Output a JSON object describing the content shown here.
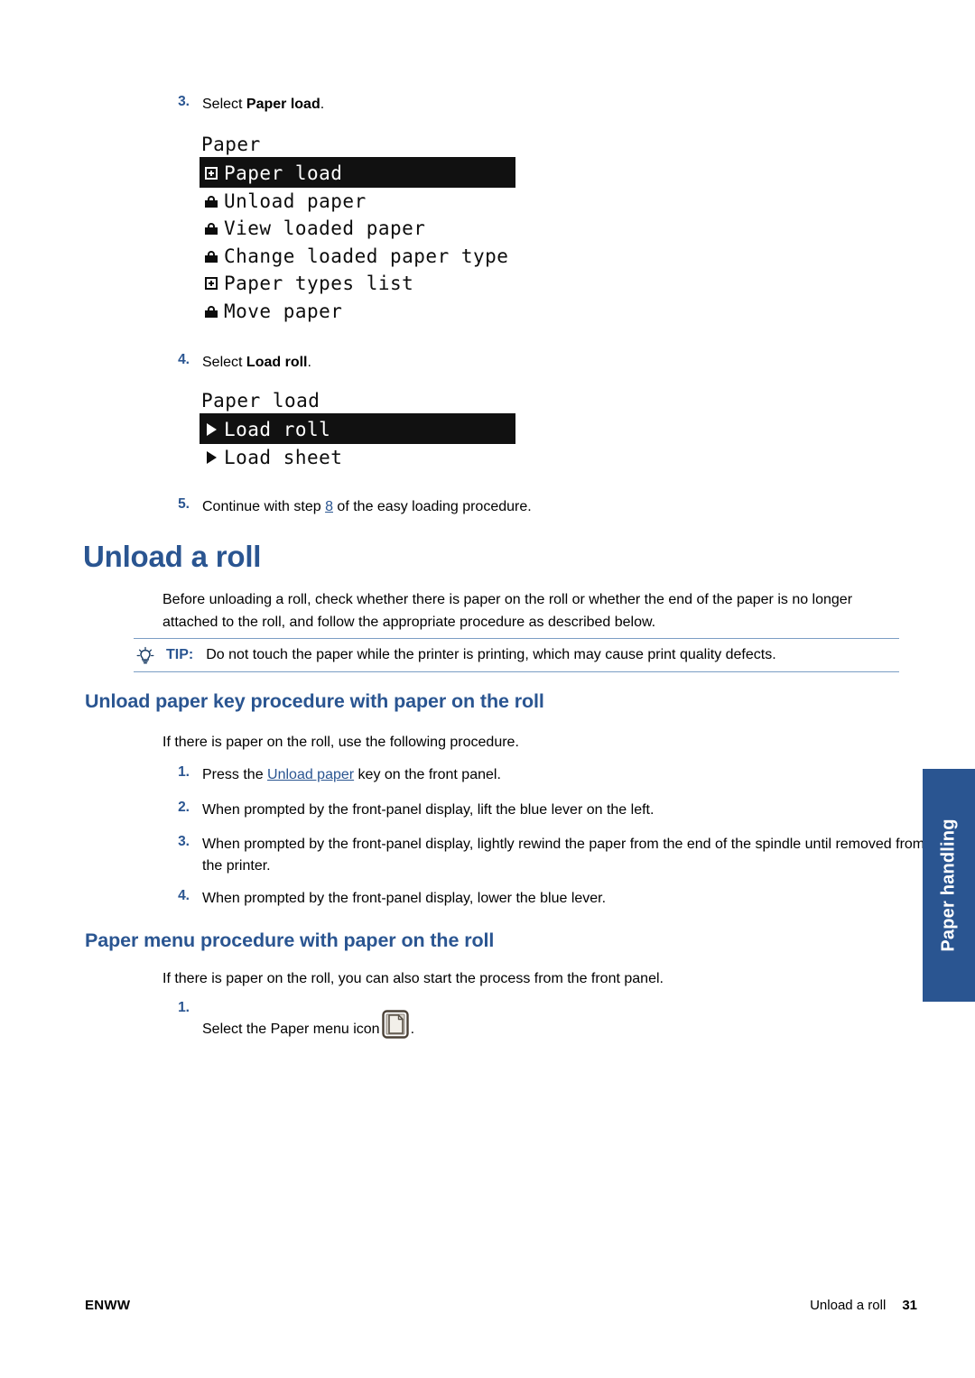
{
  "document": {
    "page_number": "31",
    "footer_left": "ENWW",
    "footer_right_title": "Unload a roll"
  },
  "side_tab": {
    "label": "Paper handling",
    "color": "#2a5591"
  },
  "top_steps": {
    "step3": {
      "number": "3.",
      "text_before": "Select ",
      "bold": "Paper load",
      "text_after": "."
    },
    "step4": {
      "number": "4.",
      "text_before": "Select ",
      "bold": "Load roll",
      "text_after": "."
    },
    "step5": {
      "number": "5.",
      "text_before": "Continue with step ",
      "link": "8",
      "text_after": " of the easy loading procedure."
    }
  },
  "lcd_paper_menu": {
    "title": "Paper",
    "rows": [
      {
        "icon": "box-plus-icon",
        "label": "Paper load",
        "selected": true
      },
      {
        "icon": "lock-icon",
        "label": "Unload paper",
        "selected": false
      },
      {
        "icon": "lock-icon",
        "label": "View loaded paper",
        "selected": false
      },
      {
        "icon": "lock-icon",
        "label": "Change loaded paper type",
        "selected": false
      },
      {
        "icon": "box-plus-icon",
        "label": "Paper types list",
        "selected": false
      },
      {
        "icon": "lock-icon",
        "label": "Move paper",
        "selected": false
      }
    ]
  },
  "lcd_paper_load_menu": {
    "title": "Paper load",
    "rows": [
      {
        "icon": "triangle-right-icon",
        "label": "Load roll",
        "selected": true
      },
      {
        "icon": "triangle-right-icon",
        "label": "Load sheet",
        "selected": false
      }
    ]
  },
  "section": {
    "heading": "Unload a roll",
    "intro": "Before unloading a roll, check whether there is paper on the roll or whether the end of the paper is no longer attached to the roll, and follow the appropriate procedure as described below.",
    "tip": {
      "icon": "lightbulb-icon",
      "label": "TIP:",
      "text": "Do not touch the paper while the printer is printing, which may cause print quality defects."
    }
  },
  "subsection_key": {
    "heading": "Unload paper key procedure with paper on the roll",
    "intro": "If there is paper on the roll, use the following procedure.",
    "steps": [
      {
        "number": "1.",
        "text_before": "Press the ",
        "link": "Unload paper",
        "text_after": " key on the front panel."
      },
      {
        "number": "2.",
        "text": "When prompted by the front-panel display, lift the blue lever on the left."
      },
      {
        "number": "3.",
        "text": "When prompted by the front-panel display, lightly rewind the paper from the end of the spindle until removed from the printer."
      },
      {
        "number": "4.",
        "text": "When prompted by the front-panel display, lower the blue lever."
      }
    ]
  },
  "subsection_menu": {
    "heading": "Paper menu procedure with paper on the roll",
    "intro": "If there is paper on the roll, you can also start the process from the front panel.",
    "step1": {
      "number": "1.",
      "text_before": "Select the Paper menu icon",
      "icon": "paper-menu-icon",
      "text_after": "."
    }
  }
}
